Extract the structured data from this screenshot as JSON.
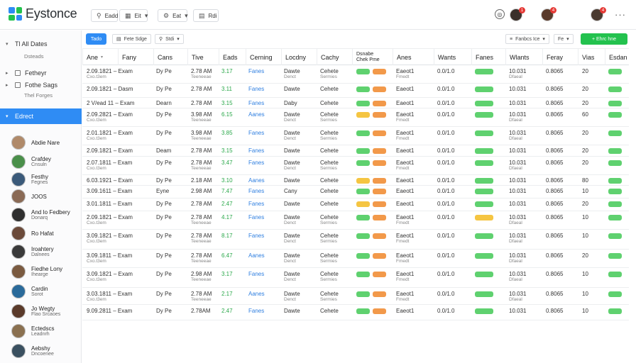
{
  "app": {
    "title": "Eystonce",
    "logo_colors": [
      "#2f8cf4",
      "#23c24e",
      "#23c24e",
      "#2f8cf4"
    ]
  },
  "topbar": {
    "buttons": [
      {
        "icon": "pin-icon",
        "glyph": "⚲",
        "label": "Eadd"
      },
      {
        "icon": "grid-icon",
        "glyph": "▦",
        "label": "Eit",
        "caret": "▾"
      },
      {
        "icon": "gear-icon",
        "glyph": "⚙",
        "label": "Eat",
        "caret": "▾"
      },
      {
        "icon": "doc-icon",
        "glyph": "▤",
        "label": "Rdi"
      }
    ],
    "help_glyph": "◎",
    "notifications": [
      "1",
      "4",
      "4"
    ],
    "more_glyph": "···"
  },
  "sidebar": {
    "sections": [
      {
        "label": "Tl All Dates",
        "sub": "Dsteads"
      },
      {
        "label": "Fetheyr",
        "sub": ""
      },
      {
        "label": "Fothe Sags",
        "sub": "Thel Forges"
      }
    ],
    "active": "Edrect",
    "people": [
      {
        "name": "Abdie Nare",
        "sub": ""
      },
      {
        "name": "Crafdey",
        "sub": "Cnsuln"
      },
      {
        "name": "Festhy",
        "sub": "Fegnes"
      },
      {
        "name": "JOOS",
        "sub": ""
      },
      {
        "name": "And Io Fedbery",
        "sub": "Donarq"
      },
      {
        "name": "Ro Hafat",
        "sub": ""
      },
      {
        "name": "Iroahtery",
        "sub": "Dalnees"
      },
      {
        "name": "Fiedhe Lony",
        "sub": "Ihearge"
      },
      {
        "name": "Cardin",
        "sub": "Sorot"
      },
      {
        "name": "Jo Wegty",
        "sub": "Flao Srcaoes"
      },
      {
        "name": "Ectedscs",
        "sub": "Leadnrh"
      },
      {
        "name": "Aebshy",
        "sub": "Dncoenee"
      }
    ]
  },
  "toolbar": {
    "primary": "Tado",
    "chips": [
      {
        "glyph": "▤",
        "label": "Fete Sdge"
      },
      {
        "glyph": "⚲",
        "label": "Stdi",
        "caret": "▾"
      }
    ],
    "right_chips": [
      {
        "glyph": "≡",
        "label": "Fanbcs Ice",
        "caret": "▾"
      },
      {
        "glyph": "",
        "label": "Fe",
        "caret": "▾"
      }
    ],
    "add_button": "+ Ehrc hne"
  },
  "table": {
    "headers": [
      "Ane",
      "Fany",
      "Cans",
      "Tive",
      "Eads",
      "Cerning",
      "Locdny",
      "Cachy",
      "Dsnabe\nChek Pme",
      "Anes",
      "Wants",
      "Fanes",
      "Wlants",
      "Feray",
      "Vias",
      "Esdan"
    ],
    "rows": [
      {
        "date": "2.09.1821 – Exam",
        "dsub": "Cxo.t3em",
        "cat": "Dy Pe",
        "time": "2.78 AM",
        "tsub": "Teeneeae",
        "num": "3.17",
        "link": "Fanes",
        "loc": "Dawte",
        "lsub": "Denct",
        "ch": "Cehete",
        "chsub": "Sermies",
        "p1": "#5fd16f",
        "p2": "#f2994a",
        "code": "Eaeot1",
        "csub": "Fmedt",
        "amt": "0.0/1.0",
        "p3": "#5fd16f",
        "idx": "10.031",
        "isub": "Dfaeal",
        "val": "0.8065",
        "q": "20",
        "p4": "#5fd16f"
      },
      {
        "date": "2.09.1821 – Dasm",
        "dsub": "Coanal Pnen",
        "cat": "Dy Pe",
        "time": "2.78 AM",
        "tsub": "Teeneeae",
        "num": "3.11",
        "link": "Fanes",
        "loc": "Dawte",
        "lsub": "Denct",
        "ch": "Cehete",
        "chsub": "Sermies",
        "p1": "#5fd16f",
        "p2": "#f2994a",
        "code": "Eaeot1",
        "csub": "Fmedt",
        "amt": "0.0/1.0",
        "p3": "#5fd16f",
        "idx": "10.031",
        "isub": "Dfaeal",
        "val": "0.8065",
        "q": "20",
        "p4": "#5fd16f"
      },
      {
        "date": "2 V/ead 11 – Exam",
        "dsub": "",
        "cat": "Dearn",
        "time": "2.78 AM",
        "tsub": "",
        "num": "3.15",
        "link": "Fanes",
        "loc": "Daby",
        "lsub": "",
        "ch": "Cehete",
        "chsub": "",
        "p1": "#5fd16f",
        "p2": "#f2994a",
        "code": "Eaeot1",
        "csub": "",
        "amt": "0.0/1.0",
        "p3": "#5fd16f",
        "idx": "10.031",
        "isub": "",
        "val": "0.8065",
        "q": "20",
        "p4": "#5fd16f"
      },
      {
        "date": "2.09.2821 – Exam",
        "dsub": "Cxo.t3em",
        "cat": "Dy Pe",
        "time": "3.98 AM",
        "tsub": "Teeneeae",
        "num": "6.15",
        "link": "Aanes",
        "loc": "Dawte",
        "lsub": "Denct",
        "ch": "Cehete",
        "chsub": "Sermies",
        "p1": "#f5c542",
        "p2": "#f2994a",
        "code": "Eaeot1",
        "csub": "Fmedt",
        "amt": "0.0/1.0",
        "p3": "#5fd16f",
        "idx": "10.031",
        "isub": "Dfaeal",
        "val": "0.8065",
        "q": "60",
        "p4": "#5fd16f"
      },
      {
        "date": "2.01.1821 – Exam",
        "dsub": "Cxo.t3em",
        "cat": "Dy Pe",
        "time": "3.98 AM",
        "tsub": "Teeneeae",
        "num": "3.85",
        "link": "Fanes",
        "loc": "Dawte",
        "lsub": "Denct",
        "ch": "Cehete",
        "chsub": "Sermies",
        "p1": "#5fd16f",
        "p2": "#f2994a",
        "code": "Eaeot1",
        "csub": "Fmedt",
        "amt": "0.0/1.0",
        "p3": "#5fd16f",
        "idx": "10.031",
        "isub": "Dfaeal",
        "val": "0.8065",
        "q": "20",
        "p4": "#5fd16f"
      },
      {
        "date": "2.09.1821 – Exam",
        "dsub": "",
        "cat": "Deam",
        "time": "2.78 AM",
        "tsub": "",
        "num": "3.15",
        "link": "Fanes",
        "loc": "Dawte",
        "lsub": "",
        "ch": "Cehete",
        "chsub": "",
        "p1": "#5fd16f",
        "p2": "#f2994a",
        "code": "Eaeot1",
        "csub": "",
        "amt": "0.0/1.0",
        "p3": "#5fd16f",
        "idx": "10.031",
        "isub": "",
        "val": "0.8065",
        "q": "20",
        "p4": "#5fd16f"
      },
      {
        "date": "2.07.1811 – Exam",
        "dsub": "Cxo.t3em",
        "cat": "Dy Pe",
        "time": "2.78 AM",
        "tsub": "Teeneeae",
        "num": "3.47",
        "link": "Fanes",
        "loc": "Dawte",
        "lsub": "Denct",
        "ch": "Cehete",
        "chsub": "Sermies",
        "p1": "#5fd16f",
        "p2": "#f2994a",
        "code": "Eaeot1",
        "csub": "Fmedt",
        "amt": "0.0/1.0",
        "p3": "#5fd16f",
        "idx": "10.031",
        "isub": "Dfaeal",
        "val": "0.8065",
        "q": "20",
        "p4": "#5fd16f"
      },
      {
        "date": "6.03.1921 – Exam",
        "dsub": "Cxo.t3em",
        "cat": "Dy Pe",
        "time": "2.18 AM",
        "tsub": "Teeneeae",
        "num": "3.10",
        "link": "Aanes",
        "loc": "Dawte",
        "lsub": "Denct",
        "ch": "Cehete",
        "chsub": "Sermies",
        "p1": "#f5c542",
        "p2": "#f2994a",
        "code": "Eaeot1",
        "csub": "Fmedt",
        "amt": "0.0/1.0",
        "p3": "#5fd16f",
        "idx": "10.031",
        "isub": "Dfaeal",
        "val": "0.8065",
        "q": "80",
        "p4": "#5fd16f"
      },
      {
        "date": "3.09.1611 – Exam",
        "dsub": "",
        "cat": "Eyne",
        "time": "2.98 AM",
        "tsub": "",
        "num": "7.47",
        "link": "Fanes",
        "loc": "Cany",
        "lsub": "",
        "ch": "Cehete",
        "chsub": "",
        "p1": "#5fd16f",
        "p2": "#f2994a",
        "code": "Eaeot1",
        "csub": "",
        "amt": "0.0/1.0",
        "p3": "#5fd16f",
        "idx": "10.031",
        "isub": "",
        "val": "0.8065",
        "q": "10",
        "p4": "#5fd16f"
      },
      {
        "date": "3.01.1811 – Exam",
        "dsub": "",
        "cat": "Dy Pe",
        "time": "2.78 AM",
        "tsub": "",
        "num": "2.47",
        "link": "Fanes",
        "loc": "Dawte",
        "lsub": "",
        "ch": "Cehete",
        "chsub": "",
        "p1": "#f5c542",
        "p2": "#f2994a",
        "code": "Eaeot1",
        "csub": "",
        "amt": "0.0/1.0",
        "p3": "#5fd16f",
        "idx": "10.031",
        "isub": "",
        "val": "0.8065",
        "q": "20",
        "p4": "#5fd16f"
      },
      {
        "date": "2.09.1821 – Exam",
        "dsub": "Cxo.t3em",
        "cat": "Dy Pe",
        "time": "2.78 AM",
        "tsub": "Teeneeae",
        "num": "4.17",
        "link": "Fanes",
        "loc": "Dawte",
        "lsub": "Denct",
        "ch": "Cehete",
        "chsub": "Sermies",
        "p1": "#5fd16f",
        "p2": "#f2994a",
        "code": "Eaeot1",
        "csub": "Fmedt",
        "amt": "0.0/1.0",
        "p3": "#f5c542",
        "idx": "10.031",
        "isub": "Dfaeal",
        "val": "0.8065",
        "q": "10",
        "p4": "#5fd16f"
      },
      {
        "date": "3.09.1821 – Exam",
        "dsub": "Cxo.t3em",
        "cat": "Dy Pe",
        "time": "2.78 AM",
        "tsub": "Teeneeae",
        "num": "8.17",
        "link": "Fanes",
        "loc": "Dawte",
        "lsub": "Denct",
        "ch": "Cehete",
        "chsub": "Sermies",
        "p1": "#5fd16f",
        "p2": "#f2994a",
        "code": "Eaeot1",
        "csub": "Fmedt",
        "amt": "0.0/1.0",
        "p3": "#5fd16f",
        "idx": "10.031",
        "isub": "Dfaeal",
        "val": "0.8065",
        "q": "10",
        "p4": "#5fd16f"
      },
      {
        "date": "3.09.1811 – Exam",
        "dsub": "Cxo.t3em",
        "cat": "Dy Pe",
        "time": "2.78 AM",
        "tsub": "Teeneeae",
        "num": "6.47",
        "link": "Aanes",
        "loc": "Dawte",
        "lsub": "Denct",
        "ch": "Cehete",
        "chsub": "Sermies",
        "p1": "#5fd16f",
        "p2": "#f2994a",
        "code": "Eaeot1",
        "csub": "Fmedt",
        "amt": "0.0/1.0",
        "p3": "#5fd16f",
        "idx": "10.031",
        "isub": "Dfaeal",
        "val": "0.8065",
        "q": "20",
        "p4": "#5fd16f"
      },
      {
        "date": "3.09.1821 – Exam",
        "dsub": "Cxo.t3em",
        "cat": "Dy Pe",
        "time": "2.98 AM",
        "tsub": "Teeneeae",
        "num": "3.17",
        "link": "Fanes",
        "loc": "Dawte",
        "lsub": "Denct",
        "ch": "Cehete",
        "chsub": "Sermies",
        "p1": "#5fd16f",
        "p2": "#f2994a",
        "code": "Eaeot1",
        "csub": "Fmedt",
        "amt": "0.0/1.0",
        "p3": "#5fd16f",
        "idx": "10.031",
        "isub": "Dfaeal",
        "val": "0.8065",
        "q": "10",
        "p4": "#5fd16f"
      },
      {
        "date": "3.03.1811 – Exam",
        "dsub": "Cxo.t3em",
        "cat": "Dy Pe",
        "time": "2.78 AM",
        "tsub": "Teeneeae",
        "num": "2.17",
        "link": "Aanes",
        "loc": "Dawte",
        "lsub": "Denct",
        "ch": "Cehete",
        "chsub": "Sermies",
        "p1": "#5fd16f",
        "p2": "#f2994a",
        "code": "Eaeot1",
        "csub": "Fmedt",
        "amt": "0.0/1.0",
        "p3": "#5fd16f",
        "idx": "10.031",
        "isub": "Dfaeal",
        "val": "0.8065",
        "q": "10",
        "p4": "#5fd16f"
      },
      {
        "date": "9.09.2811 – Exam",
        "dsub": "",
        "cat": "Dy Pe",
        "time": "2.78AM",
        "tsub": "",
        "num": "2.47",
        "link": "Fanes",
        "loc": "Dawte",
        "lsub": "",
        "ch": "Cehete",
        "chsub": "",
        "p1": "#5fd16f",
        "p2": "#f2994a",
        "code": "Eaeot1",
        "csub": "",
        "amt": "0.0/1.0",
        "p3": "#5fd16f",
        "idx": "10.031",
        "isub": "",
        "val": "0.8065",
        "q": "10",
        "p4": "#5fd16f"
      }
    ]
  }
}
